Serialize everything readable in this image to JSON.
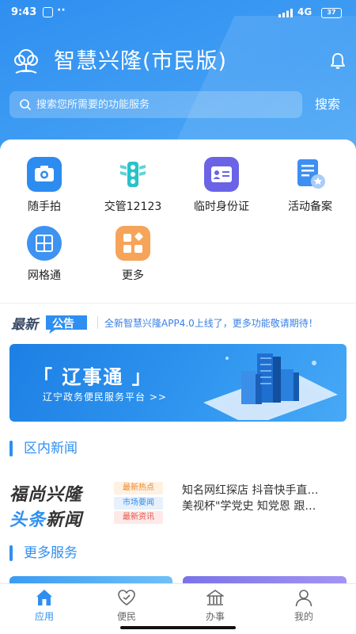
{
  "status_bar": {
    "time": "9:43",
    "network": "4G",
    "battery": "37"
  },
  "header": {
    "title": "智慧兴隆(市民版)",
    "search_placeholder": "搜索您所需要的功能服务",
    "search_button": "搜索"
  },
  "functions": [
    {
      "label": "随手拍",
      "icon": "camera-icon",
      "color": "#2d8cf0"
    },
    {
      "label": "交管12123",
      "icon": "traffic-light-icon",
      "color": "#27c3c9"
    },
    {
      "label": "临时身份证",
      "icon": "id-card-icon",
      "color": "#6b63e6"
    },
    {
      "label": "活动备案",
      "icon": "file-record-icon",
      "color": "#3d8ff2"
    },
    {
      "label": "网格通",
      "icon": "grid-icon",
      "color": "#3d92f2"
    },
    {
      "label": "更多",
      "icon": "more-apps-icon",
      "color": "#f6a45a"
    }
  ],
  "notice": {
    "badge_prefix": "最新",
    "badge_suffix": "公告",
    "text": "全新智慧兴隆APP4.0上线了，更多功能敬请期待！"
  },
  "banner": {
    "title": "「 辽事通 」",
    "subtitle": "辽宁政务便民服务平台 >>"
  },
  "news_section": {
    "title": "区内新闻",
    "brand_line1": "福尚兴隆",
    "brand_line2_a": "头条",
    "brand_line2_b": "新闻",
    "tags": [
      {
        "label": "最新热点",
        "color": "#e8882c",
        "bg": "#fff1e2"
      },
      {
        "label": "市场要闻",
        "color": "#2f8ff0",
        "bg": "#e6f1fd"
      },
      {
        "label": "最新资讯",
        "color": "#e4534a",
        "bg": "#fde9e8"
      }
    ],
    "items": [
      "知名网红探店  抖音快手直…",
      "美视杯\"学党史 知党恩 跟…"
    ]
  },
  "more_section": {
    "title": "更多服务"
  },
  "tabbar": [
    {
      "label": "应用",
      "icon": "home-icon",
      "active": true
    },
    {
      "label": "便民",
      "icon": "heart-icon",
      "active": false
    },
    {
      "label": "办事",
      "icon": "building-icon",
      "active": false
    },
    {
      "label": "我的",
      "icon": "user-icon",
      "active": false
    }
  ]
}
